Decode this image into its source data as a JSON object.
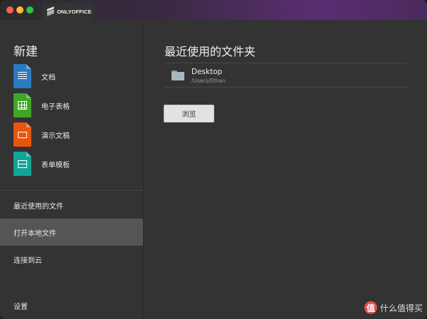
{
  "titlebar": {
    "app_name": "ONLYOFFICE"
  },
  "sidebar": {
    "new_title": "新建",
    "new_items": [
      {
        "label": "文档",
        "icon": "document-icon",
        "color": "#2a7ac0"
      },
      {
        "label": "电子表格",
        "icon": "spreadsheet-icon",
        "color": "#40a528"
      },
      {
        "label": "演示文稿",
        "icon": "presentation-icon",
        "color": "#e8560e"
      },
      {
        "label": "表单模板",
        "icon": "form-template-icon",
        "color": "#12a596"
      }
    ],
    "nav": [
      {
        "label": "最近使用的文件",
        "active": false
      },
      {
        "label": "打开本地文件",
        "active": true
      },
      {
        "label": "连接到云",
        "active": false
      }
    ],
    "settings_label": "设置"
  },
  "main": {
    "title": "最近使用的文件夹",
    "folders": [
      {
        "name": "Desktop",
        "path": "/Users/Ethan"
      }
    ],
    "browse_label": "浏览"
  },
  "watermark": {
    "badge": "值",
    "text": "什么值得买"
  }
}
